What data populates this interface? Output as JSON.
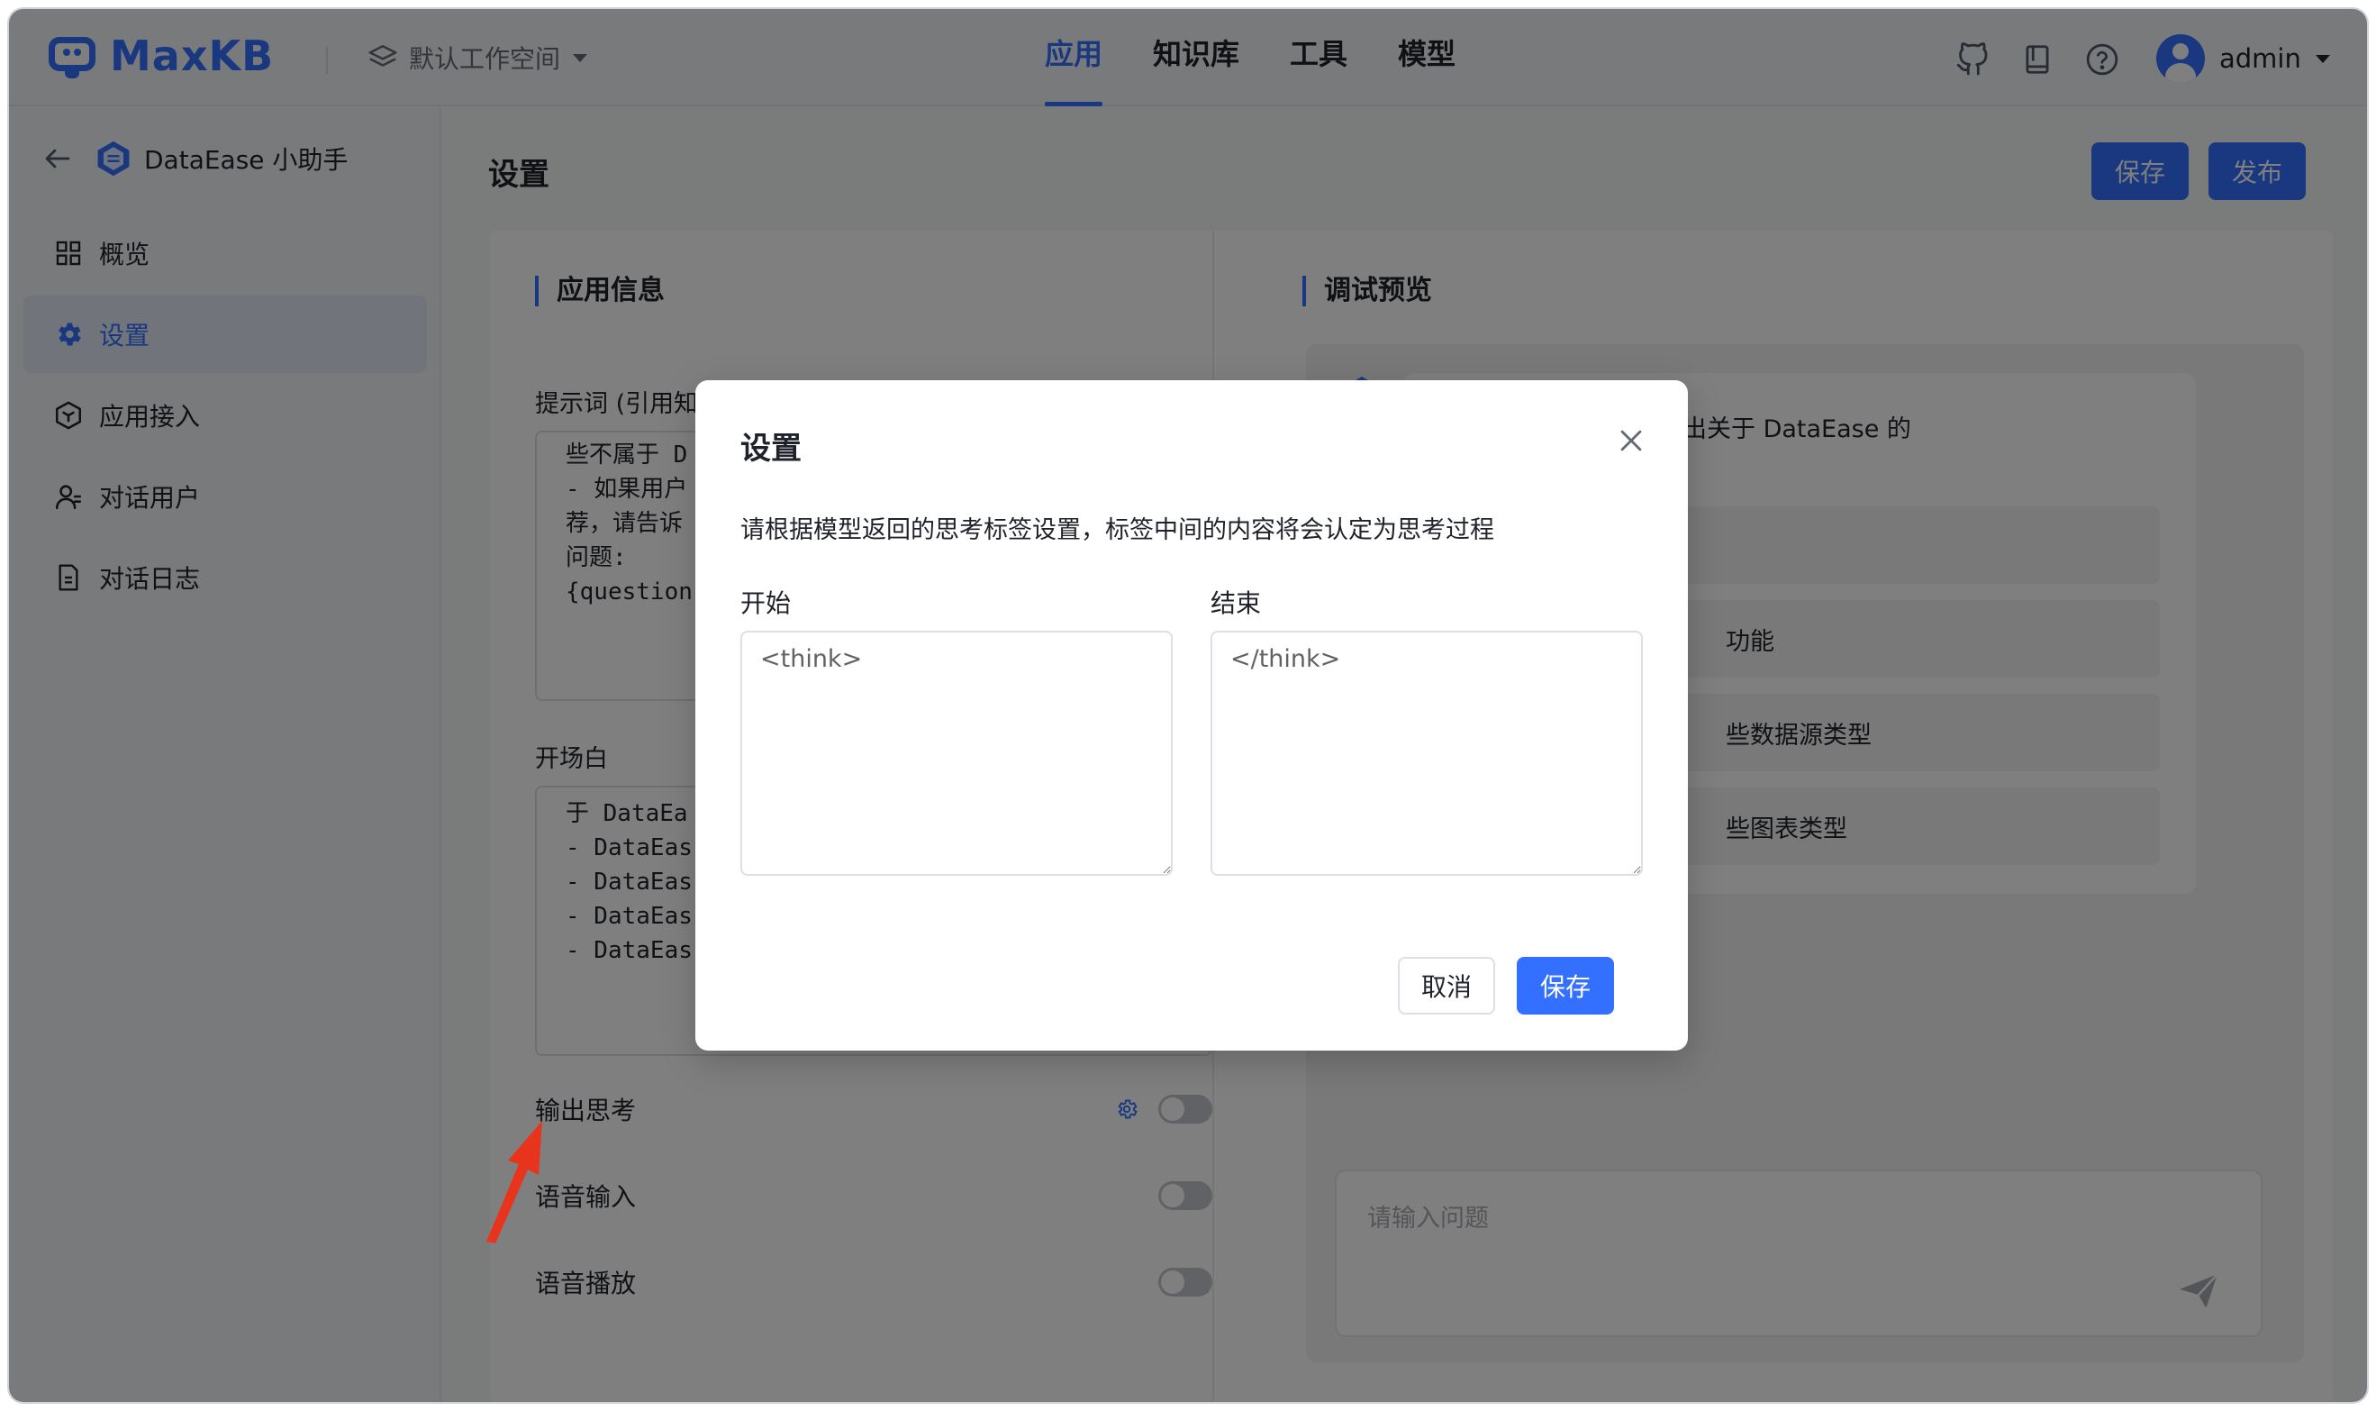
{
  "app": {
    "brand": "MaxKB",
    "workspace": "默认工作空间"
  },
  "nav": {
    "tabs": [
      "应用",
      "知识库",
      "工具",
      "模型"
    ],
    "active_index": 0
  },
  "user": {
    "name": "admin"
  },
  "sidebar": {
    "app_title": "DataEase 小助手",
    "items": [
      {
        "label": "概览",
        "icon": "grid-icon"
      },
      {
        "label": "设置",
        "icon": "gear-icon",
        "active": true
      },
      {
        "label": "应用接入",
        "icon": "hexagon-box-icon"
      },
      {
        "label": "对话用户",
        "icon": "user-icon"
      },
      {
        "label": "对话日志",
        "icon": "document-icon"
      }
    ]
  },
  "page": {
    "title": "设置",
    "save_label": "保存",
    "publish_label": "发布"
  },
  "app_info": {
    "section_title": "应用信息",
    "prompt_label": "提示词 (引用知",
    "prompt_lines": [
      "些不属于 D",
      "- 如果用户",
      "荐，请告诉",
      "问题:",
      "{question"
    ],
    "opening_label": "开场白",
    "opening_lines": [
      "于 DataEa",
      "- DataEas",
      "- DataEas",
      "- DataEas",
      "- DataEas"
    ],
    "switches": [
      {
        "label": "输出思考",
        "has_settings": true,
        "on": false
      },
      {
        "label": "语音输入",
        "on": false
      },
      {
        "label": "语音播放",
        "on": false
      }
    ]
  },
  "debug": {
    "section_title": "调试预览",
    "intro": "小助手，您可以向我提出关于 DataEase 的",
    "questions": [
      "",
      "功能",
      "些数据源类型",
      "些图表类型"
    ],
    "input_placeholder": "请输入问题"
  },
  "dialog": {
    "title": "设置",
    "description": "请根据模型返回的思考标签设置，标签中间的内容将会认定为思考过程",
    "start_label": "开始",
    "start_value": "<think>",
    "end_label": "结束",
    "end_value": "</think>",
    "cancel_label": "取消",
    "save_label": "保存"
  },
  "colors": {
    "primary": "#3370ff",
    "annotation_arrow": "#e8341c"
  }
}
